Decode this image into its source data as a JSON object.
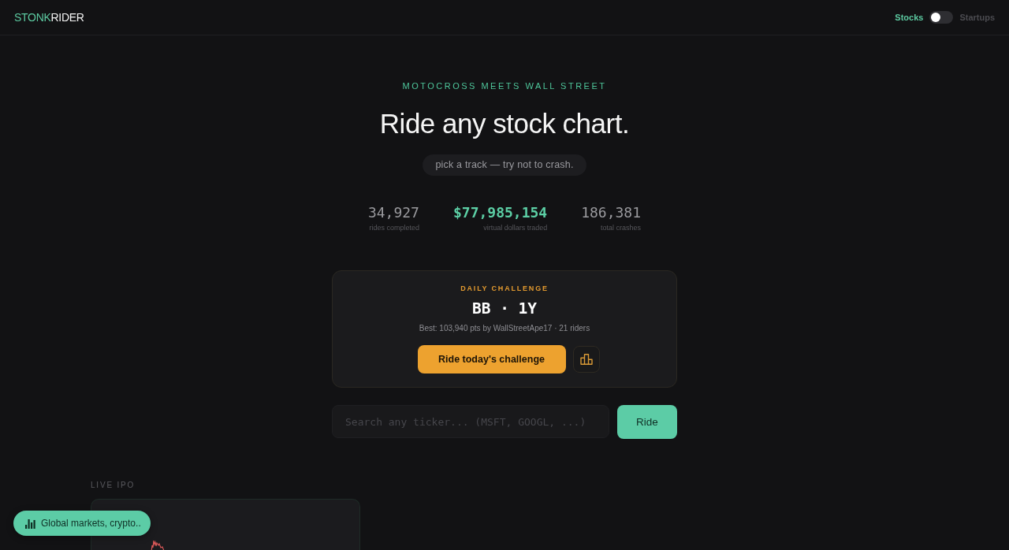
{
  "header": {
    "logo": {
      "accent": "STONK",
      "text": "RIDER"
    },
    "mode_toggle": {
      "left_label": "Stocks",
      "right_label": "Startups",
      "on": false
    }
  },
  "hero": {
    "eyebrow": "MOTOCROSS MEETS WALL STREET",
    "title": "Ride any stock chart.",
    "tagline": "pick a track — try not to crash."
  },
  "stats": [
    {
      "value": "34,927",
      "label": "rides completed",
      "highlight": false
    },
    {
      "value": "$77,985,154",
      "label": "virtual dollars traded",
      "highlight": true
    },
    {
      "value": "186,381",
      "label": "total crashes",
      "highlight": false
    }
  ],
  "daily_challenge": {
    "eyebrow": "DAILY CHALLENGE",
    "title": "BB · 1Y",
    "summary": "Best: 103,940 pts by WallStreetApe17 · 21 riders",
    "button": "Ride today's challenge"
  },
  "search": {
    "placeholder": "Search any ticker... (MSFT, GOOGL, ...)",
    "button": "Ride"
  },
  "live_ipo": {
    "heading": "LIVE IPO"
  },
  "floating_button": {
    "label": "Global markets, crypto.."
  }
}
